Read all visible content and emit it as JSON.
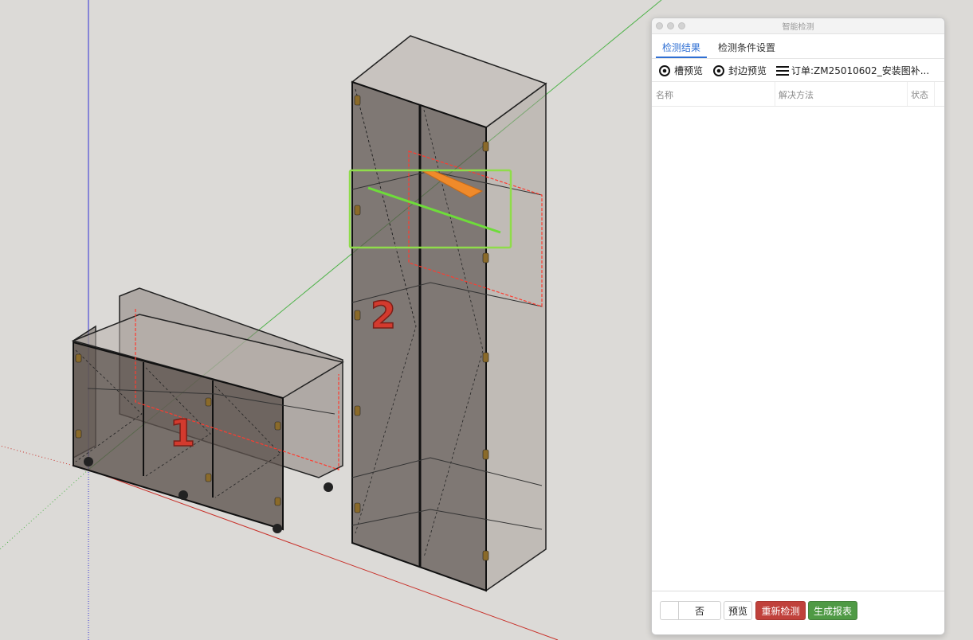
{
  "window": {
    "title": "智能检测"
  },
  "tabs": [
    {
      "label": "检测结果",
      "active": true
    },
    {
      "label": "检测条件设置",
      "active": false
    }
  ],
  "toolbar": {
    "groove_preview": "槽预览",
    "edge_preview": "封边预览",
    "order_label": "订单:ZM25010602_安装图补..."
  },
  "table": {
    "columns": [
      "名称",
      "解决方法",
      "状态"
    ],
    "rows": []
  },
  "footer": {
    "no_label": "否",
    "preview_label": "预览",
    "recheck_label": "重新检测",
    "report_label": "生成报表"
  },
  "scene": {
    "cabinet_1_label": "1",
    "cabinet_2_label": "2"
  },
  "colors": {
    "accent_blue": "#2f6fd3",
    "recheck_red": "#c0413b",
    "report_green": "#4f9a45",
    "highlight_green": "#8fdc4a",
    "highlight_orange": "#f08a2a",
    "dashed_red": "#ff3b2f"
  }
}
